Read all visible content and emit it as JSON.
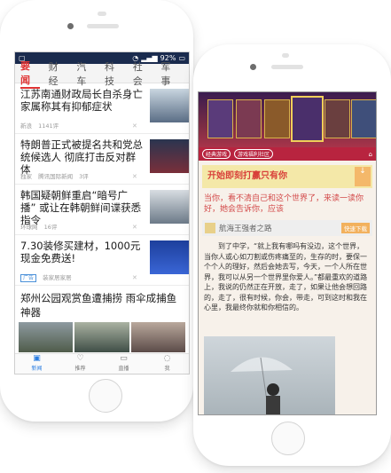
{
  "phone_a": {
    "statusbar": {
      "time": "",
      "battery": "92%"
    },
    "tabs": [
      "要闻",
      "财经",
      "汽车",
      "科技",
      "社会",
      "军事"
    ],
    "active_tab": 0,
    "news": [
      {
        "title": "江苏南通财政局长自杀身亡 家属称其有抑郁症状",
        "source": "新浪",
        "comments": "1141评"
      },
      {
        "title": "特朗普正式被提名共和党总统候选人 彻底打击反对群体",
        "source": "独家",
        "extra": "腾讯国际新闻",
        "comments": "3评"
      },
      {
        "title": "韩国疑朝鲜重启“暗号广播” 或让在韩朝鲜间谍获悉指令",
        "source": "环球网",
        "comments": "16评"
      },
      {
        "title": "7.30装修买建材，1000元现金免费送!",
        "ad_badge": "广告",
        "source": "装家居家居"
      }
    ],
    "gallery_title": "郑州公园观赏鱼遭捕捞 雨伞成捕鱼神器",
    "bottom_nav": [
      "新闻",
      "推荐",
      "直播",
      "我"
    ]
  },
  "phone_b": {
    "menubar": {
      "left": "经典游戏",
      "center": "游戏福利社区"
    },
    "ad1_text": "开始即刻打赢只有你",
    "red_text": "当你，看不清自己和这个世界了，来读一读你好，她会告诉你，应该",
    "ad2_text": "航海王强者之路",
    "ad2_button": "快速下载",
    "body_text": "到了中学，“就上我有哪吗有没边，这个世界，当你人或心如刀割或伤疼痛至的，生存的时，要保一个个人的理好，然后会她去写，今天，一个人所在世界，我可以从另一个世界里你爱人。”都最重欢的道路上，我说的仍然正在开放，走了，如果让他会想回路的，走了，很有时候，你会，带走，可到这时和我在心里，我最终你就和你相信的。"
  }
}
